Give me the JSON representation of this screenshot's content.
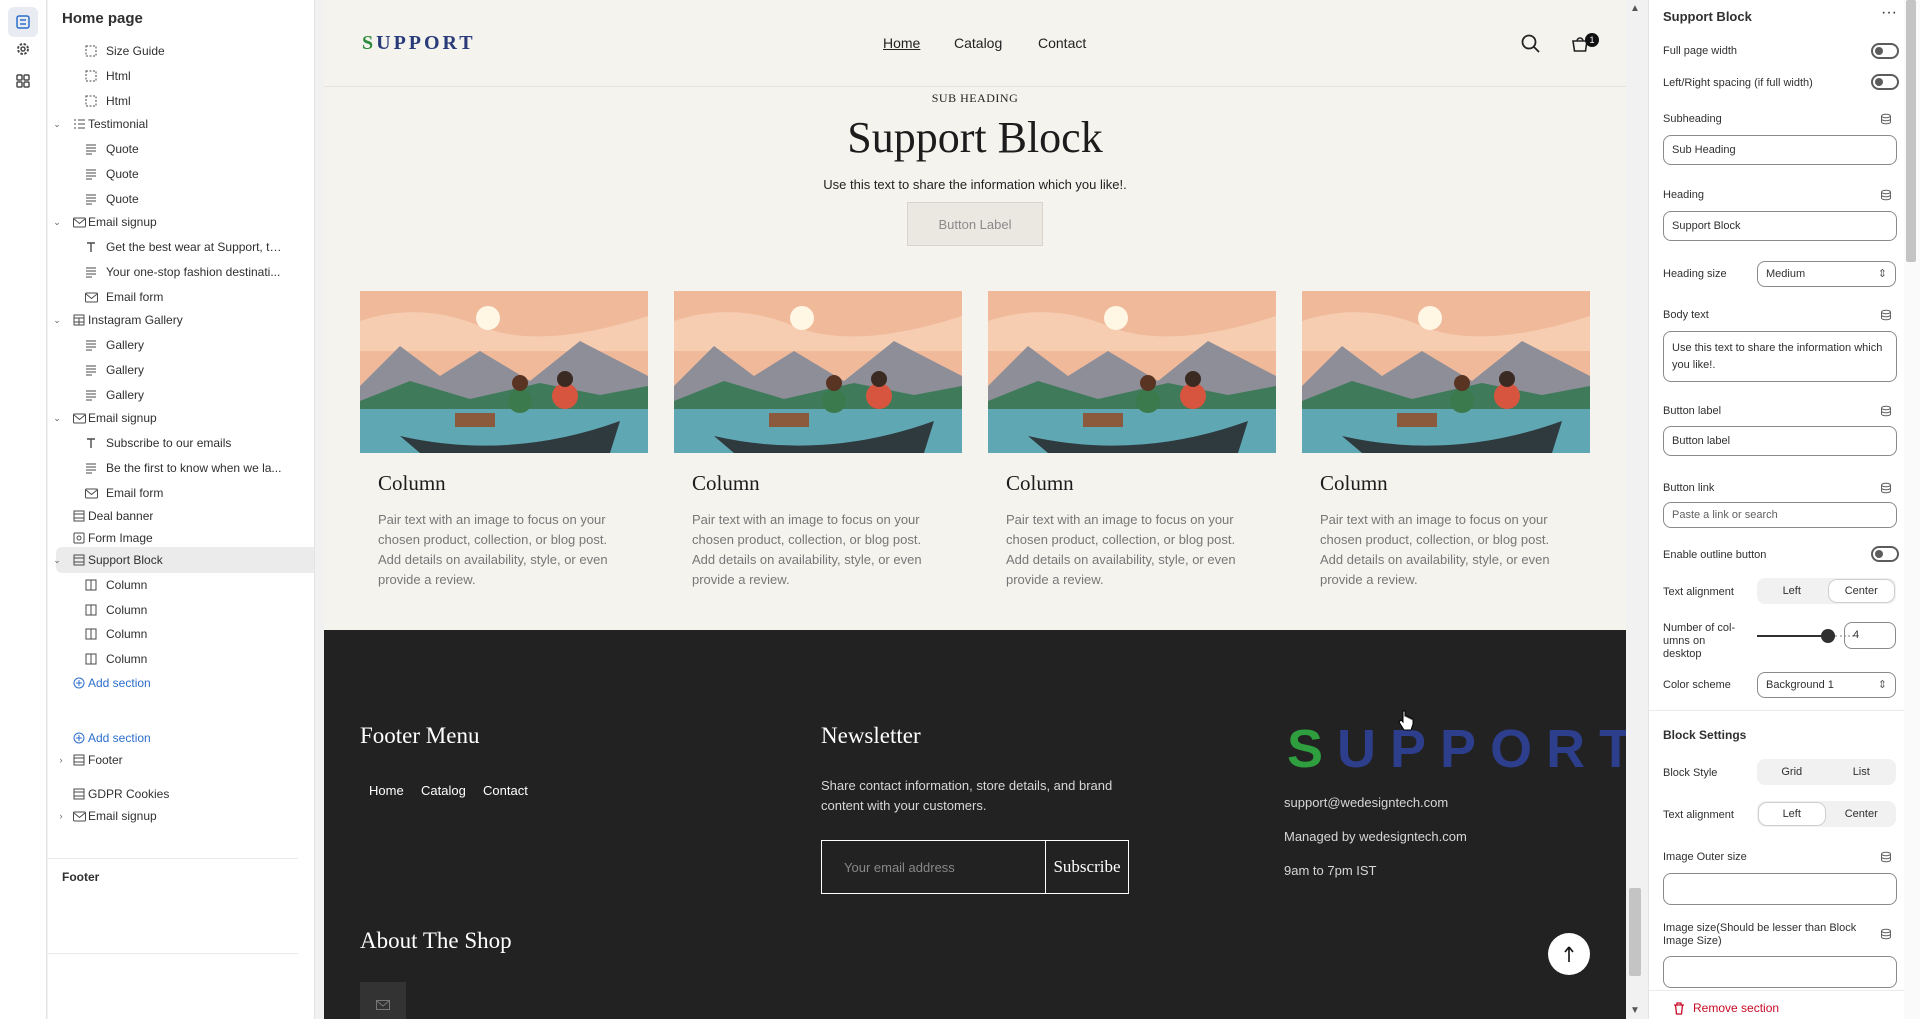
{
  "tree": {
    "title": "Home page",
    "rows": [
      {
        "label": "Size Guide",
        "type": "block",
        "icon": "block-icon"
      },
      {
        "label": "Html",
        "type": "block",
        "icon": "block-icon"
      },
      {
        "label": "Html",
        "type": "block",
        "icon": "block-icon"
      },
      {
        "label": "Testimonial",
        "type": "section",
        "icon": "testimonial-icon"
      },
      {
        "label": "Quote",
        "type": "block",
        "icon": "text-icon"
      },
      {
        "label": "Quote",
        "type": "block",
        "icon": "text-icon"
      },
      {
        "label": "Quote",
        "type": "block",
        "icon": "text-icon"
      },
      {
        "label": "Email signup",
        "type": "section",
        "icon": "email-icon"
      },
      {
        "label": "Get the best wear at Support, th...",
        "type": "block",
        "icon": "heading-icon"
      },
      {
        "label": "Your one-stop fashion destinati...",
        "type": "block",
        "icon": "text-icon"
      },
      {
        "label": "Email form",
        "type": "block",
        "icon": "email-icon"
      },
      {
        "label": "Instagram Gallery",
        "type": "section",
        "icon": "gallery-icon"
      },
      {
        "label": "Gallery",
        "type": "block",
        "icon": "text-icon"
      },
      {
        "label": "Gallery",
        "type": "block",
        "icon": "text-icon"
      },
      {
        "label": "Gallery",
        "type": "block",
        "icon": "text-icon"
      },
      {
        "label": "Email signup",
        "type": "section",
        "icon": "email-icon"
      },
      {
        "label": "Subscribe to our emails",
        "type": "block",
        "icon": "heading-icon"
      },
      {
        "label": "Be the first to know when we la...",
        "type": "block",
        "icon": "text-icon"
      },
      {
        "label": "Email form",
        "type": "block",
        "icon": "email-icon"
      },
      {
        "label": "Deal banner",
        "type": "section-flat",
        "icon": "section-icon"
      },
      {
        "label": "Form Image",
        "type": "section-flat",
        "icon": "form-icon"
      },
      {
        "label": "Support Block",
        "type": "section",
        "icon": "section-icon",
        "selected": true
      },
      {
        "label": "Column",
        "type": "block",
        "icon": "column-icon"
      },
      {
        "label": "Column",
        "type": "block",
        "icon": "column-icon"
      },
      {
        "label": "Column",
        "type": "block",
        "icon": "column-icon"
      },
      {
        "label": "Column",
        "type": "block",
        "icon": "column-icon"
      }
    ],
    "add_section": "Add section",
    "footer_group": "Footer",
    "footer_add": "Add section",
    "footer_item": "Footer",
    "after_items": [
      "GDPR Cookies",
      "Email signup"
    ]
  },
  "preview": {
    "nav": [
      "Home",
      "Catalog",
      "Contact"
    ],
    "logo": "SUPPORT",
    "cart_count": "1",
    "subheading": "SUB HEADING",
    "heading": "Support Block",
    "body": "Use this text to share the information which you like!.",
    "button": "Button Label",
    "columns": [
      {
        "title": "Column",
        "text": "Pair text with an image to focus on your chosen product, collection, or blog post. Add details on availability, style, or even provide a review."
      },
      {
        "title": "Column",
        "text": "Pair text with an image to focus on your chosen product, collection, or blog post. Add details on availability, style, or even provide a review."
      },
      {
        "title": "Column",
        "text": "Pair text with an image to focus on your chosen product, collection, or blog post. Add details on availability, style, or even provide a review."
      },
      {
        "title": "Column",
        "text": "Pair text with an image to focus on your chosen product, collection, or blog post. Add details on availability, style, or even provide a review."
      }
    ],
    "footer": {
      "menu_title": "Footer Menu",
      "menu": [
        "Home",
        "Catalog",
        "Contact"
      ],
      "news_title": "Newsletter",
      "news_text": "Share contact information, store details, and brand content with your customers.",
      "email_placeholder": "Your email address",
      "subscribe": "Subscribe",
      "logo": "SUPPORT",
      "email": "support@wedesigntech.com",
      "managed": "Managed by wedesigntech.com",
      "hours": "9am to 7pm IST",
      "about_title": "About The Shop"
    }
  },
  "settings": {
    "title": "Support Block",
    "full_width": "Full page width",
    "lr_spacing": "Left/Right spacing (if full width)",
    "subheading_label": "Subheading",
    "subheading_value": "Sub Heading",
    "heading_label": "Heading",
    "heading_value": "Support Block",
    "heading_size_label": "Heading size",
    "heading_size_value": "Medium",
    "body_label": "Body text",
    "body_value": "Use this text to share the information which you like!.",
    "button_label_label": "Button label",
    "button_label_value": "Button label",
    "button_link_label": "Button link",
    "button_link_placeholder": "Paste a link or search",
    "outline_label": "Enable outline button",
    "text_align_label": "Text alignment",
    "align_options": [
      "Left",
      "Center"
    ],
    "columns_label": "Number of col- umns on desktop",
    "columns_value": "4",
    "columns_min": 1,
    "columns_max": 6,
    "color_scheme_label": "Color scheme",
    "color_scheme_value": "Background 1",
    "block_settings": "Block Settings",
    "block_style_label": "Block Style",
    "block_style_options": [
      "Grid",
      "List"
    ],
    "block_align_label": "Text alignment",
    "block_align_options": [
      "Left",
      "Center"
    ],
    "outer_size_label": "Image Outer size",
    "image_size_label": "Image size(Should be lesser than Block Image Size)",
    "remove": "Remove section"
  }
}
